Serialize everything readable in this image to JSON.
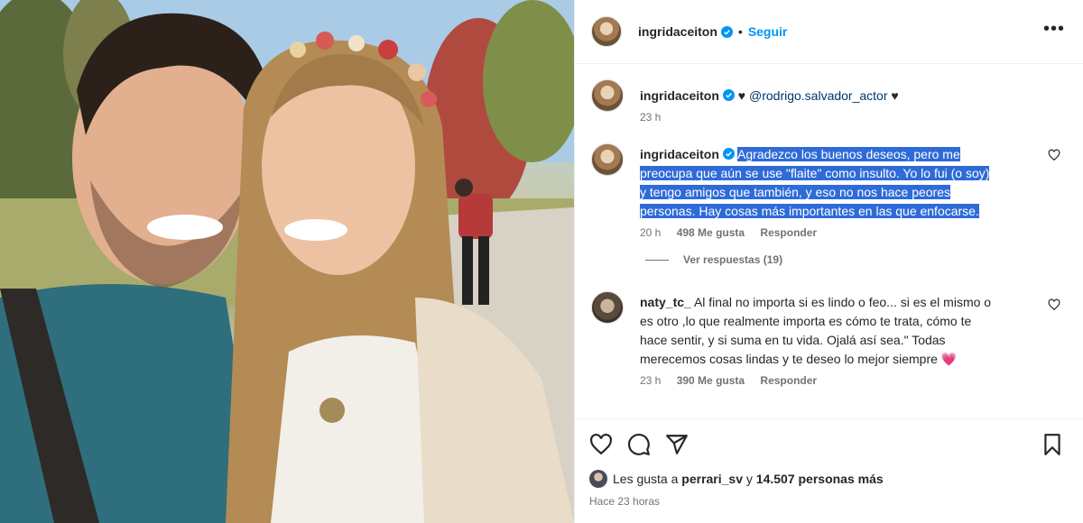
{
  "header": {
    "username": "ingridaceiton",
    "separator": "•",
    "follow_label": "Seguir",
    "more_icon": "more-horizontal-icon"
  },
  "caption": {
    "username": "ingridaceiton",
    "heart_1": "♥",
    "mention": "@rodrigo.salvador_actor",
    "heart_2": "♥",
    "time": "23 h"
  },
  "comments": [
    {
      "username": "ingridaceiton",
      "lines": [
        "Agradezco los buenos deseos, pero me",
        "preocupa que aún se use \"flaite\" como insulto. Yo lo fui (o soy)",
        "y tengo amigos que también, y eso no nos hace peores",
        "personas. Hay cosas más importantes en las que enfocarse."
      ],
      "time": "20 h",
      "likes": "498 Me gusta",
      "reply": "Responder",
      "view_replies": "Ver respuestas (19)"
    },
    {
      "username": "naty_tc_",
      "lines": [
        "Al final no importa si es lindo o feo... si es el mismo o",
        "es otro ,lo que realmente importa es cómo te trata, cómo te",
        "hace sentir, y si suma en tu vida. Ojalá así sea.\" Todas",
        "merecemos cosas lindas y te deseo lo mejor siempre"
      ],
      "emoji": "💗",
      "time": "23 h",
      "likes": "390 Me gusta",
      "reply": "Responder"
    }
  ],
  "footer": {
    "liked_prefix": "Les gusta a",
    "liked_user": "perrari_sv",
    "liked_and": "y",
    "liked_count": "14.507 personas más",
    "posted": "Hace 23 horas"
  },
  "colors": {
    "accent": "#0095f6",
    "highlight": "#2e6bd8",
    "verified": "#0095f6",
    "emoji_heart": "#e8336b"
  }
}
